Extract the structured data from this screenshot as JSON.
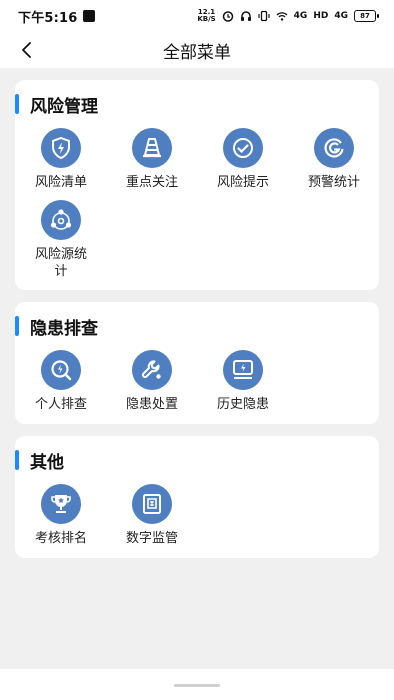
{
  "status_bar": {
    "time": "下午5:16",
    "net_speed_value": "12.1",
    "net_speed_unit": "KB/S",
    "signal_1": "4G",
    "signal_2": "HD",
    "signal_3": "4G",
    "battery": "87"
  },
  "header": {
    "title": "全部菜单"
  },
  "sections": [
    {
      "title": "风险管理",
      "items": [
        {
          "label": "风险清单",
          "icon": "shield-lightning-icon"
        },
        {
          "label": "重点关注",
          "icon": "traffic-cone-icon"
        },
        {
          "label": "风险提示",
          "icon": "check-circle-icon"
        },
        {
          "label": "预警统计",
          "icon": "warning-stat-icon"
        },
        {
          "label": "风险源统计",
          "icon": "network-nodes-icon"
        }
      ]
    },
    {
      "title": "隐患排查",
      "items": [
        {
          "label": "个人排查",
          "icon": "search-lightning-icon"
        },
        {
          "label": "隐患处置",
          "icon": "wrench-icon"
        },
        {
          "label": "历史隐患",
          "icon": "history-device-icon"
        }
      ]
    },
    {
      "title": "其他",
      "items": [
        {
          "label": "考核排名",
          "icon": "trophy-icon"
        },
        {
          "label": "数字监管",
          "icon": "week-document-icon"
        }
      ]
    }
  ],
  "colors": {
    "accent_bar": "#1a8cff",
    "icon_bg": "#4f7fc0",
    "page_bg": "#f0f0f0",
    "card_bg": "#ffffff"
  }
}
